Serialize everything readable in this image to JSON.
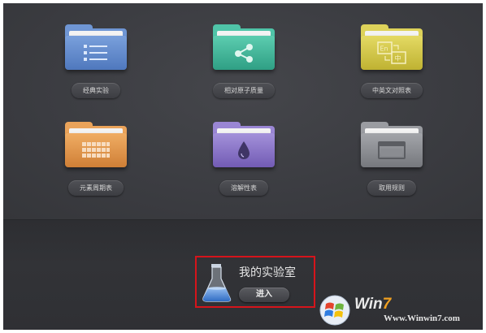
{
  "folders": [
    {
      "label": "经典实验",
      "icon": "list-icon",
      "color": "#5b86c8"
    },
    {
      "label": "相对原子质量",
      "icon": "share-icon",
      "color": "#3fb79a"
    },
    {
      "label": "中英文对照表",
      "icon": "translate-icon",
      "color": "#d6c94a",
      "icon_text_en": "En",
      "icon_text_cn": "中"
    },
    {
      "label": "元素周期表",
      "icon": "grid-icon",
      "color": "#e0924a"
    },
    {
      "label": "溶解性表",
      "icon": "drop-icon",
      "color": "#8a74c8"
    },
    {
      "label": "取用规则",
      "icon": "window-icon",
      "color": "#8d8f94"
    }
  ],
  "my_lab": {
    "title": "我的实验室",
    "button_label": "进入",
    "icon": "flask-icon"
  },
  "watermark": {
    "brand_prefix": "Win",
    "brand_seven": "7",
    "url": "Www.Winwin7.com",
    "logo": "windows-logo"
  },
  "colors": {
    "background": "#3a3b40",
    "highlight_border": "#d6141b"
  }
}
